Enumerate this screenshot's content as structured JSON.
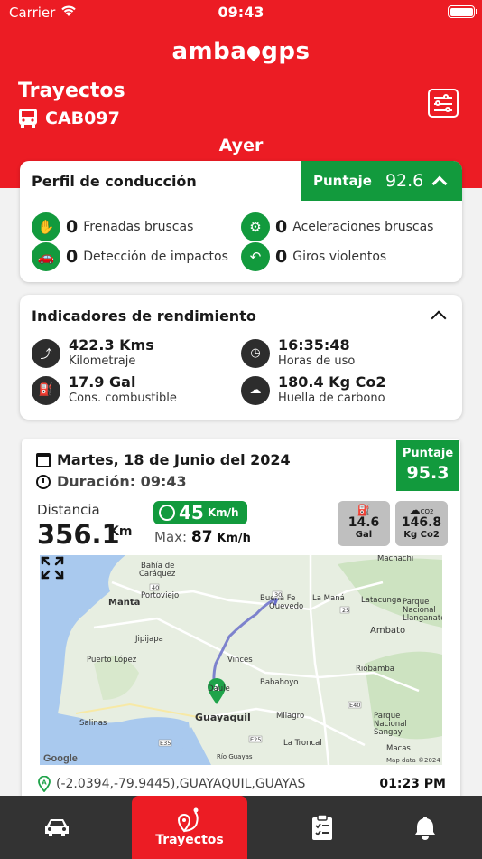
{
  "status": {
    "carrier": "Carrier",
    "time": "09:43"
  },
  "header": {
    "logo": "amba gps",
    "title": "Trayectos",
    "vehicle": "CAB097",
    "date": "Ayer"
  },
  "driving": {
    "title": "Perfil de conducción",
    "score_label": "Puntaje",
    "score": "92.6",
    "metrics": [
      {
        "count": "0",
        "label": "Frenadas bruscas"
      },
      {
        "count": "0",
        "label": "Aceleraciones bruscas"
      },
      {
        "count": "0",
        "label": "Detección de impactos"
      },
      {
        "count": "0",
        "label": "Giros violentos"
      }
    ]
  },
  "performance": {
    "title": "Indicadores de rendimiento",
    "items": [
      {
        "value": "422.3 Kms",
        "label": "Kilometraje"
      },
      {
        "value": "16:35:48",
        "label": "Horas de uso"
      },
      {
        "value": "17.9 Gal",
        "label": "Cons. combustible"
      },
      {
        "value": "180.4 Kg Co2",
        "label": "Huella de carbono"
      }
    ]
  },
  "trip": {
    "date": "Martes, 18 de Junio del 2024",
    "duration": "Duración: 09:43",
    "score_label": "Puntaje",
    "score": "95.3",
    "distance_label": "Distancia",
    "distance": "356.1",
    "distance_unit": "Km",
    "speed": "45",
    "speed_unit": "Km/h",
    "max_label": "Max:",
    "max_value": "87",
    "max_unit": "Km/h",
    "fuel_value": "14.6",
    "fuel_unit": "Gal",
    "co2_icon_text": "CO2",
    "co2_value": "146.8",
    "co2_unit": "Kg Co2",
    "start_address": "(-2.0394,-79.9445),GUAYAQUIL,GUAYAS",
    "start_time": "01:23 PM",
    "map": {
      "marker": "A",
      "places": [
        "Machachi",
        "Bahía de Caráquez",
        "Manta",
        "Portoviejo",
        "Buena Fe",
        "La Maná",
        "Latacunga",
        "Quevedo",
        "Ambato",
        "Jipijapa",
        "Parque Nacional Llanganates",
        "Puerto López",
        "Vinces",
        "Babahoyo",
        "Riobamba",
        "Daule",
        "Guayaquil",
        "Milagro",
        "Salinas",
        "Parque Nacional Sangay",
        "La Troncal",
        "Macas",
        "Río Guayas"
      ],
      "road_labels": [
        "40",
        "30",
        "25",
        "E40",
        "E25",
        "E35"
      ],
      "credit": "Map data ©2024",
      "brand": "Google"
    }
  },
  "tabs": {
    "active_label": "Trayectos"
  },
  "colors": {
    "brand_red": "#ec1c24",
    "green": "#129a3d",
    "dark": "#333333"
  }
}
